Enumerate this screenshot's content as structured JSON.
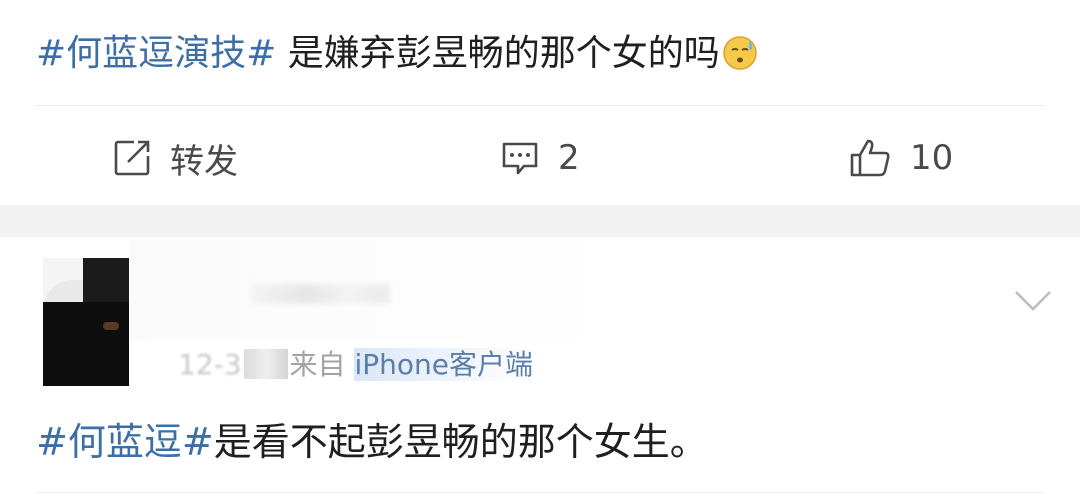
{
  "post": {
    "topic": "#何蓝逗演技#",
    "text": " 是嫌弃彭昱畅的那个女的吗",
    "emoji": "sweat-face-emoji"
  },
  "actions": {
    "repost_label": "转发",
    "comment_count": "2",
    "like_count": "10"
  },
  "comment": {
    "meta_date": "12-3",
    "meta_from": "来自",
    "meta_device": "iPhone客户端",
    "topic": "#何蓝逗#",
    "text": "是看不起彭昱畅的那个女生。"
  },
  "colors": {
    "topic": "#3d6fa6",
    "text": "#1f1f1f",
    "meta": "#a3a3a3",
    "separator_band": "#f2f2f2"
  }
}
